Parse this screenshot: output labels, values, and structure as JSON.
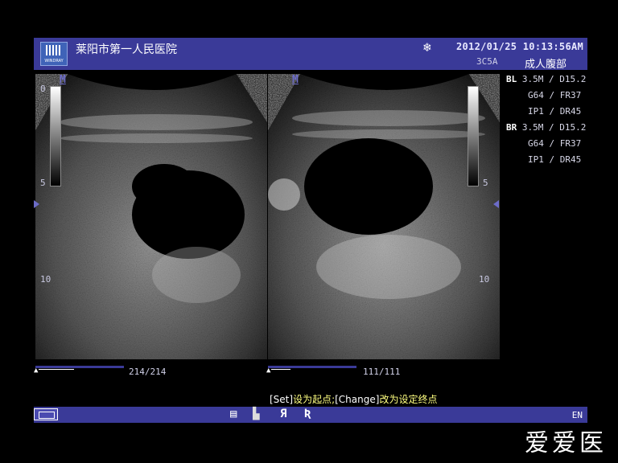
{
  "header": {
    "hospital_name": "莱阳市第一人民医院",
    "logo_text": "WINDRAY",
    "datetime": "2012/01/25  10:13:56AM",
    "probe": "3C5A",
    "exam": "成人腹部"
  },
  "params": [
    {
      "tag": "BL",
      "value": "3.5M / D15.2"
    },
    {
      "tag": "",
      "value": "G64 / FR37"
    },
    {
      "tag": "",
      "value": "IP1 / DR45"
    },
    {
      "tag": "BR",
      "value": "3.5M / D15.2"
    },
    {
      "tag": "",
      "value": "G64 / FR37"
    },
    {
      "tag": "",
      "value": "IP1 / DR45"
    }
  ],
  "left_panel": {
    "mode_icon": "M",
    "depth_labels": [
      "0",
      "5",
      "10"
    ],
    "frame_counter": "214/214"
  },
  "right_panel": {
    "mode_icon": "M",
    "depth_labels": [
      "5",
      "10"
    ],
    "frame_counter": "111/111"
  },
  "hint": {
    "set_key": "[Set]",
    "set_text": "设为起点;",
    "change_key": "[Change]",
    "change_text": "改为设定终点"
  },
  "footer": {
    "language": "EN",
    "icons": [
      "layout-icon",
      "document-icon",
      "cursor-mode-icon",
      "flip-left-icon",
      "flip-right-icon"
    ]
  },
  "watermark": "爱爱医",
  "colors": {
    "bar": "#3a3a98",
    "hint": "#ffff80"
  }
}
